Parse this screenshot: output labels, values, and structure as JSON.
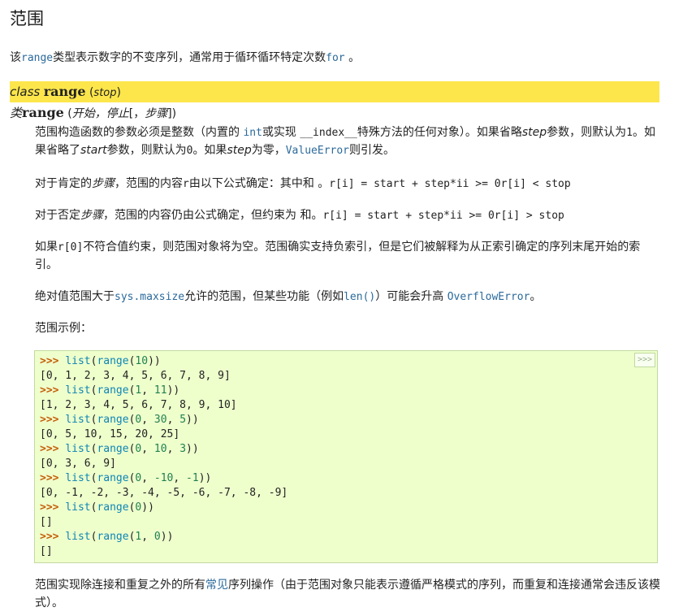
{
  "title": "范围",
  "intro": {
    "t1": "该",
    "c1": "range",
    "t2": "类型表示数字的不变序列，通常用于循环循环特定次数",
    "c2": "for",
    "t3": " 。"
  },
  "sig1": {
    "kw": "class",
    "name": "range",
    "open": " (",
    "param": "stop",
    "close": ")"
  },
  "sig2": {
    "kw": "类",
    "name": "range",
    "open": " (",
    "p1": "开始，",
    "p2": "停止",
    "bo": "[，",
    "p3": "步骤",
    "bc": "]",
    "close": ")"
  },
  "para1": {
    "a": "范围构造函数的参数必须是整数（内置的 ",
    "c1": "int",
    "b": "或实现 ",
    "c2": "__index__",
    "c": "特殊方法的任何对象）。如果省略",
    "d": "step",
    "e": "参数，则默认为",
    "c3": "1",
    "f": "。如果省略了",
    "g": "start",
    "h": "参数，则默认为",
    "c4": "0",
    "i": "。如果",
    "j": "step",
    "k": "为零，",
    "c5": "ValueError",
    "l": "则引发。"
  },
  "para2": {
    "a": "对于肯定的",
    "b": "步骤",
    "c": "，范围的内容",
    "c1": "r",
    "d": "由以下公式确定：其中和 。",
    "c2": "r[i] = start + step*ii >= 0r[i] < stop"
  },
  "para3": {
    "a": "对于否定",
    "b": "步骤",
    "c": "，范围的内容仍由公式确定，但约束为 和。",
    "c1": "r[i] = start + step*ii >= 0r[i] > stop"
  },
  "para4": {
    "a": "如果",
    "c1": "r[0]",
    "b": "不符合值约束，则范围对象将为空。范围确实支持负索引，但是它们被解释为从正索引确定的序列末尾开始的索引。"
  },
  "para5": {
    "a": "绝对值范围大于",
    "c1": "sys.maxsize",
    "b": "允许的范围，但某些功能（例如",
    "c2": "len()",
    "c": "）可能会升高 ",
    "c3": "OverflowError",
    "d": "。"
  },
  "para6": "范围示例：",
  "code": {
    "copy": ">>>",
    "lines": [
      {
        "kind": "in",
        "prompt": ">>> ",
        "text": "list(range(10))"
      },
      {
        "kind": "out",
        "text": "[0, 1, 2, 3, 4, 5, 6, 7, 8, 9]"
      },
      {
        "kind": "in",
        "prompt": ">>> ",
        "text": "list(range(1, 11))"
      },
      {
        "kind": "out",
        "text": "[1, 2, 3, 4, 5, 6, 7, 8, 9, 10]"
      },
      {
        "kind": "in",
        "prompt": ">>> ",
        "text": "list(range(0, 30, 5))"
      },
      {
        "kind": "out",
        "text": "[0, 5, 10, 15, 20, 25]"
      },
      {
        "kind": "in",
        "prompt": ">>> ",
        "text": "list(range(0, 10, 3))"
      },
      {
        "kind": "out",
        "text": "[0, 3, 6, 9]"
      },
      {
        "kind": "in",
        "prompt": ">>> ",
        "text": "list(range(0, -10, -1))"
      },
      {
        "kind": "out",
        "text": "[0, -1, -2, -3, -4, -5, -6, -7, -8, -9]"
      },
      {
        "kind": "in",
        "prompt": ">>> ",
        "text": "list(range(0))"
      },
      {
        "kind": "out",
        "text": "[]"
      },
      {
        "kind": "in",
        "prompt": ">>> ",
        "text": "list(range(1, 0))"
      },
      {
        "kind": "out",
        "text": "[]"
      }
    ]
  },
  "para7": {
    "a": "范围实现除连接和重复之外的所有",
    "link": "常见",
    "b": "序列操作（由于范围对象只能表示遵循严格模式的序列，而重复和连接通常会违反该模式）。"
  }
}
